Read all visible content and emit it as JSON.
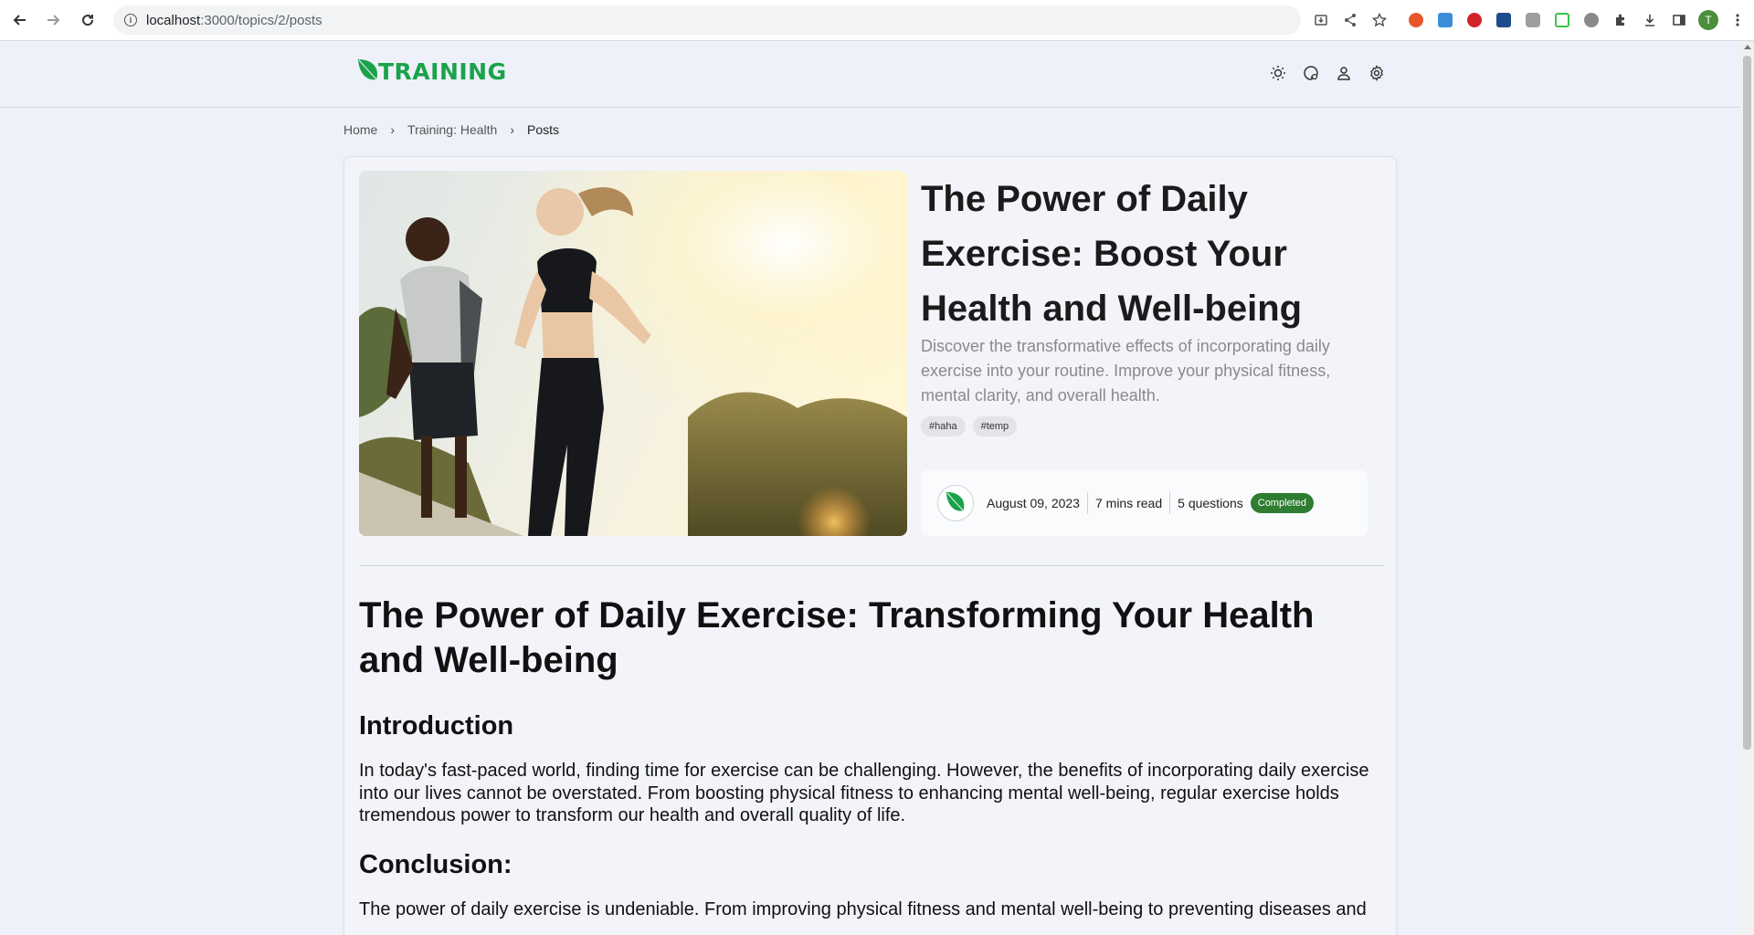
{
  "browser": {
    "url_host": "localhost",
    "url_path": ":3000/topics/2/posts",
    "profile_initial": "T"
  },
  "header": {
    "logo_text": "TRAINING",
    "brand_color": "#1aa24b"
  },
  "breadcrumb": {
    "items": [
      "Home",
      "Training: Health",
      "Posts"
    ]
  },
  "hero": {
    "title": "The Power of Daily Exercise: Boost Your Health and Well-being",
    "description": "Discover the transformative effects of incorporating daily exercise into your routine. Improve your physical fitness, mental clarity, and overall health.",
    "tags": [
      "#haha",
      "#temp"
    ]
  },
  "meta": {
    "date": "August 09, 2023",
    "read_time": "7 mins read",
    "questions": "5 questions",
    "status": "Completed",
    "status_color": "#2e7d32"
  },
  "article": {
    "title": "The Power of Daily Exercise: Transforming Your Health and Well-being",
    "sections": [
      {
        "heading": "Introduction",
        "body": "In today's fast-paced world, finding time for exercise can be challenging. However, the benefits of incorporating daily exercise into our lives cannot be overstated. From boosting physical fitness to enhancing mental well-being, regular exercise holds tremendous power to transform our health and overall quality of life."
      },
      {
        "heading": "Conclusion:",
        "body": "The power of daily exercise is undeniable. From improving physical fitness and mental well-being to preventing diseases and"
      }
    ]
  }
}
